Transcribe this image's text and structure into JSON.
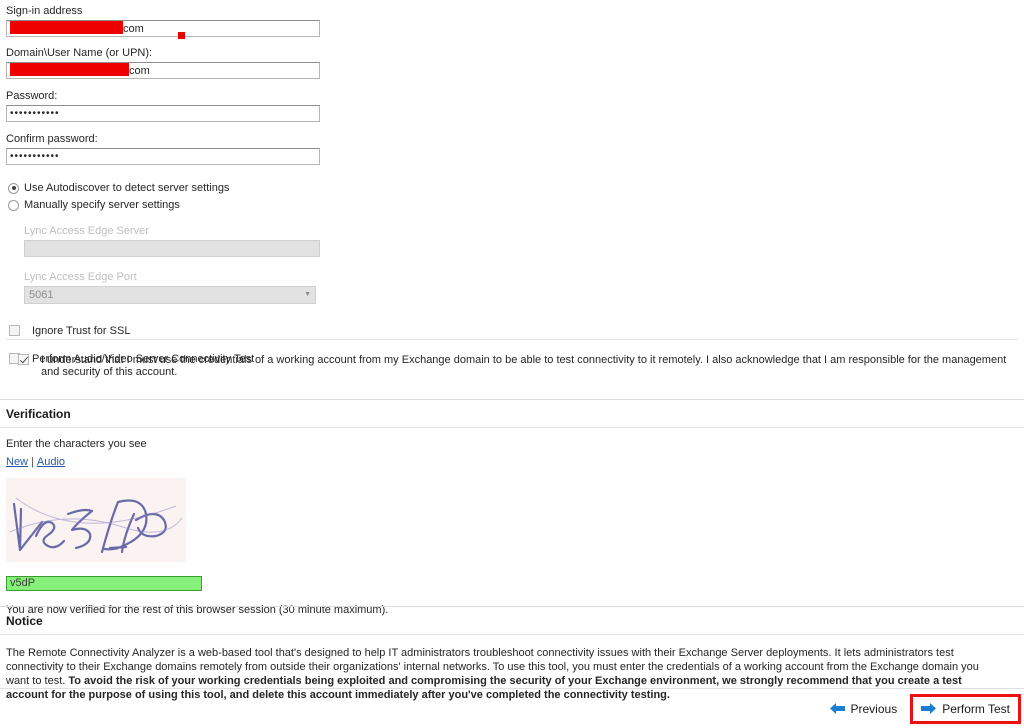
{
  "form": {
    "signin": {
      "label": "Sign-in address",
      "redacted_value": "",
      "visible_suffix": "com"
    },
    "domain_user": {
      "label": "Domain\\User Name (or UPN):",
      "redacted_value": "",
      "visible_suffix": "com"
    },
    "password": {
      "label": "Password:",
      "value": "•••••••••••"
    },
    "confirm_password": {
      "label": "Confirm password:",
      "value": "•••••••••••"
    },
    "server_settings": {
      "autodiscover_label": "Use Autodiscover to detect server settings",
      "manual_label": "Manually specify server settings",
      "edge_server_label": "Lync Access Edge Server",
      "edge_server_value": "",
      "edge_port_label": "Lync Access Edge Port",
      "edge_port_value": "5061"
    },
    "ignore_ssl_label": "Ignore Trust for SSL",
    "av_test_label": "Perform Audio/Video Server Connectivity Test",
    "acknowledge_label": "I understand that I must use the credentials of a working account from my Exchange domain to be able to test connectivity to it remotely. I also acknowledge that I am responsible for the management and security of this account."
  },
  "verification": {
    "heading": "Verification",
    "prompt": "Enter the characters you see",
    "new_link": "New",
    "separator": "|",
    "audio_link": "Audio",
    "captcha_text": "v5dP",
    "input_value": "v5dP",
    "status": "You are now verified for the rest of this browser session (30 minute maximum)."
  },
  "notice": {
    "heading": "Notice",
    "part1": "The Remote Connectivity Analyzer is a web-based tool that's designed to help IT administrators troubleshoot connectivity issues with their Exchange Server deployments. It lets administrators test connectivity to their Exchange domains remotely from outside their organizations' internal networks. To use this tool, you must enter the credentials of a working account from the Exchange domain you want to test. ",
    "part2_bold": "To avoid the risk of your working credentials being exploited and compromising the security of your Exchange environment, we strongly recommend that you create a test account for the purpose of using this tool, and delete this account immediately after you've completed the connectivity testing."
  },
  "nav": {
    "previous_label": "Previous",
    "perform_test_label": "Perform Test"
  },
  "colors": {
    "redaction": "#ee0000",
    "highlight_box": "#ee1111",
    "captcha_fill": "#86f07b",
    "captcha_border": "#3a9e2f",
    "arrow_blue": "#1a7fd4",
    "link": "#2a58a8"
  }
}
